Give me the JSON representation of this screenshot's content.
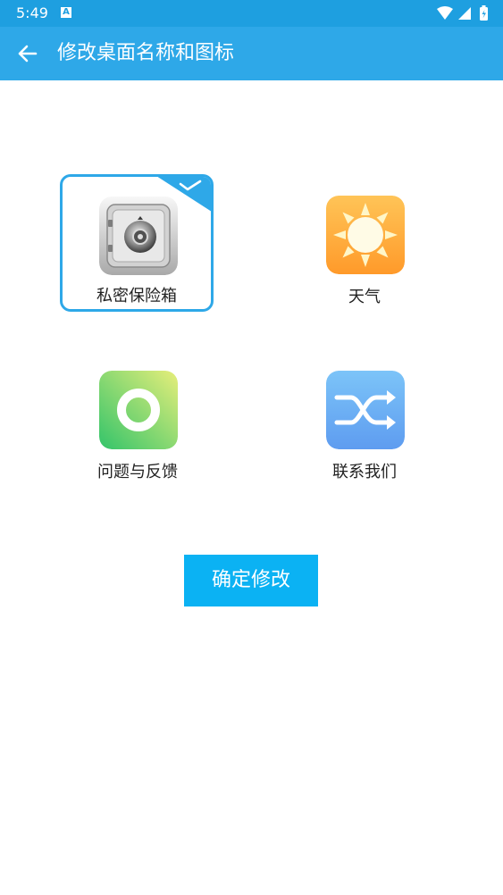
{
  "status_bar": {
    "time": "5:49",
    "notification_glyph": "A",
    "icons": [
      "wifi-icon",
      "signal-icon",
      "battery-icon"
    ]
  },
  "app_bar": {
    "title": "修改桌面名称和图标",
    "back_icon": "arrow-left-icon"
  },
  "icons": [
    {
      "label": "私密保险箱",
      "icon": "safe-icon",
      "selected": true
    },
    {
      "label": "天气",
      "icon": "sun-icon",
      "selected": false
    },
    {
      "label": "问题与反馈",
      "icon": "ring-icon",
      "selected": false
    },
    {
      "label": "联系我们",
      "icon": "shuffle-icon",
      "selected": false
    }
  ],
  "confirm_label": "确定修改",
  "colors": {
    "status_bar": "#1e9fe0",
    "app_bar": "#2ea8e8",
    "accent": "#0bb2f3",
    "selection_border": "#2ea8e8"
  }
}
